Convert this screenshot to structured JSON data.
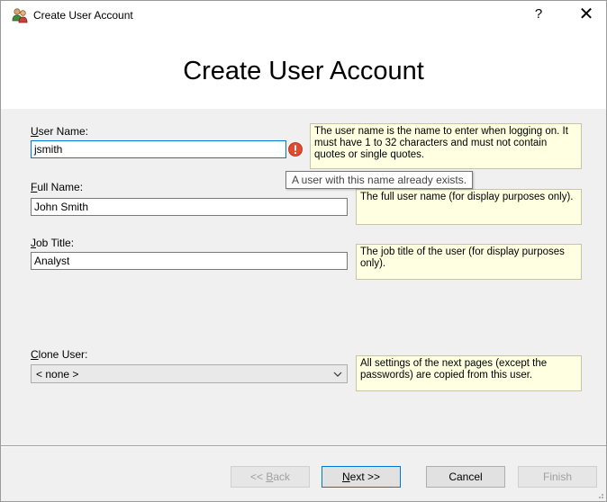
{
  "window": {
    "title": "Create User Account",
    "help_label": "?",
    "close_label": "✕"
  },
  "header": {
    "title": "Create User Account"
  },
  "fields": {
    "user_name": {
      "label_underlined": "U",
      "label_rest": "ser Name:",
      "value": "jsmith",
      "hint": "The user name is the name to enter when logging on. It must have 1 to 32 characters and must not contain quotes or single quotes.",
      "error_tooltip": "A user with this name already exists."
    },
    "full_name": {
      "label_underlined": "F",
      "label_rest": "ull Name:",
      "value": "John Smith",
      "hint": "The full user name (for display purposes only)."
    },
    "job_title": {
      "label_underlined": "J",
      "label_rest": "ob Title:",
      "value": "Analyst",
      "hint": "The job title of the user (for display purposes only)."
    },
    "clone_user": {
      "label_underlined": "C",
      "label_rest": "lone User:",
      "value": "< none >",
      "hint": "All settings of the next pages (except the passwords) are copied from this user."
    }
  },
  "buttons": {
    "back_prefix": "<< ",
    "back_underlined": "B",
    "back_rest": "ack",
    "next_underlined": "N",
    "next_rest": "ext  >>",
    "cancel": "Cancel",
    "finish": "Finish"
  },
  "icons": {
    "app": "users-icon",
    "error": "error-icon",
    "dropdown": "chevron-down-icon"
  },
  "colors": {
    "hint_background": "#ffffe1",
    "error_red": "#e04a2e",
    "focus_border": "#0078d7"
  }
}
